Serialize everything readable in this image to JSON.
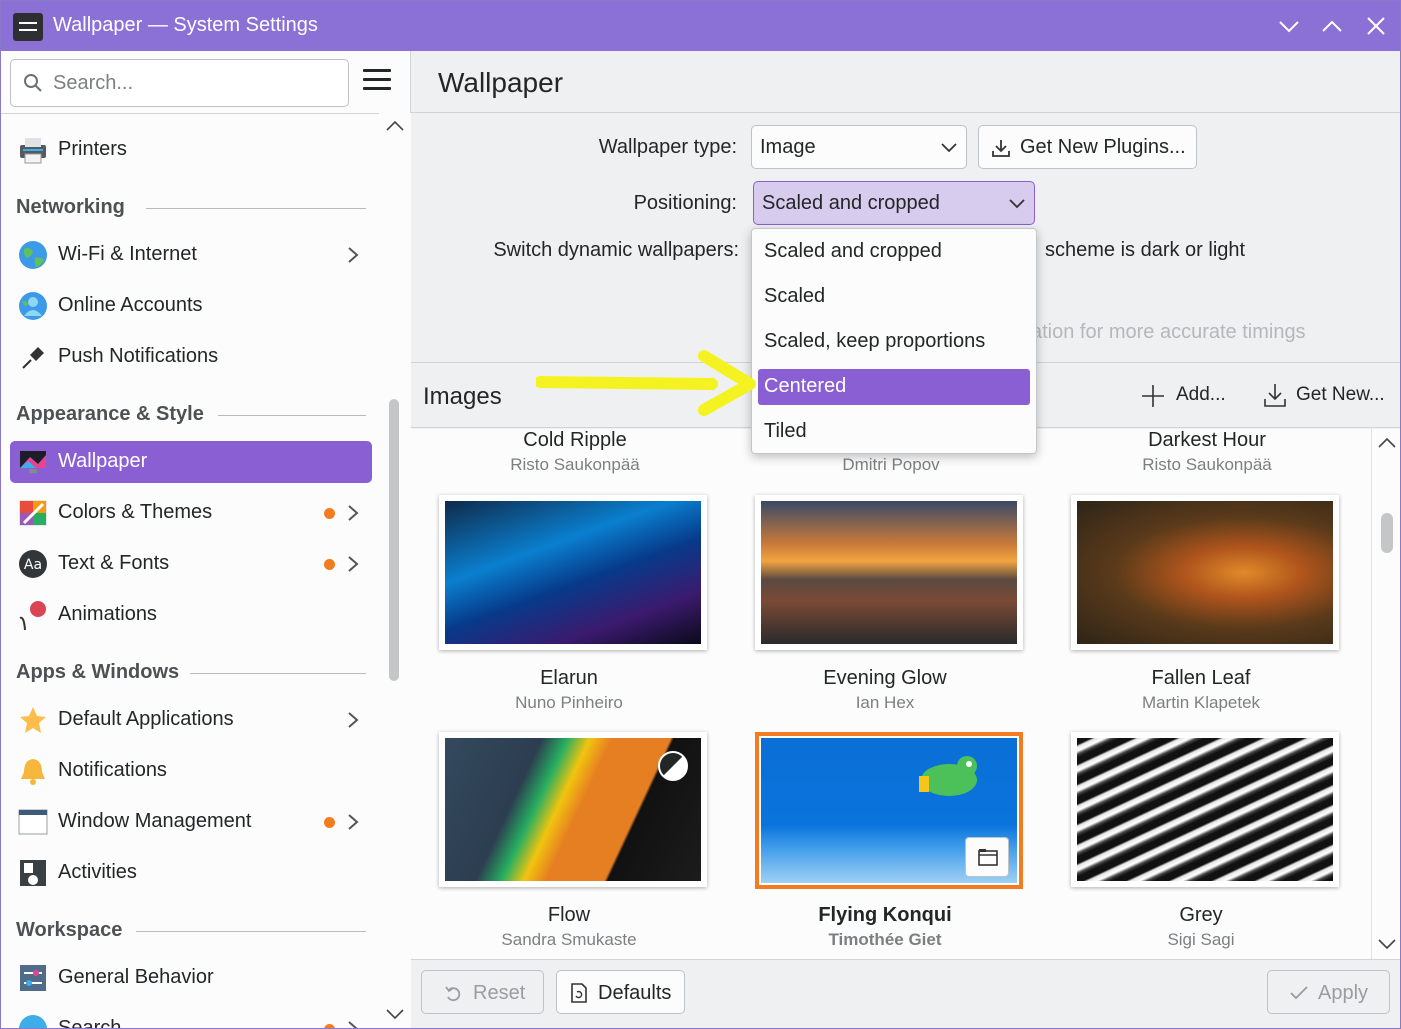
{
  "window": {
    "title": "Wallpaper — System Settings"
  },
  "sidebar": {
    "search_placeholder": "Search...",
    "items": [
      {
        "label": "Printers"
      },
      {
        "heading": "Networking"
      },
      {
        "label": "Wi-Fi & Internet",
        "chevron": true
      },
      {
        "label": "Online Accounts"
      },
      {
        "label": "Push Notifications"
      },
      {
        "heading": "Appearance & Style"
      },
      {
        "label": "Wallpaper",
        "active": true
      },
      {
        "label": "Colors & Themes",
        "dot": true,
        "chevron": true
      },
      {
        "label": "Text & Fonts",
        "dot": true,
        "chevron": true
      },
      {
        "label": "Animations"
      },
      {
        "heading": "Apps & Windows"
      },
      {
        "label": "Default Applications",
        "chevron": true
      },
      {
        "label": "Notifications"
      },
      {
        "label": "Window Management",
        "dot": true,
        "chevron": true
      },
      {
        "label": "Activities"
      },
      {
        "heading": "Workspace"
      },
      {
        "label": "General Behavior"
      },
      {
        "label": "Search",
        "dot": true,
        "chevron": true
      }
    ]
  },
  "main": {
    "title": "Wallpaper",
    "wallpaper_type_label": "Wallpaper type:",
    "wallpaper_type_value": "Image",
    "get_plugins_label": "Get New Plugins...",
    "positioning_label": "Positioning:",
    "positioning_value": "Scaled and cropped",
    "switch_label": "Switch dynamic wallpapers:",
    "switch_value_visible": "scheme is dark or light",
    "hint_visible": "ation for more accurate timings",
    "images_title": "Images",
    "add_label": "Add...",
    "get_new_label": "Get New...",
    "wallpapers": [
      {
        "name": "Cold Ripple",
        "author": "Risto Saukonpää"
      },
      {
        "name": "",
        "author": "Dmitri Popov"
      },
      {
        "name": "Darkest Hour",
        "author": "Risto Saukonpää"
      },
      {
        "name": "Elarun",
        "author": "Nuno Pinheiro"
      },
      {
        "name": "Evening Glow",
        "author": "Ian Hex"
      },
      {
        "name": "Fallen Leaf",
        "author": "Martin Klapetek"
      },
      {
        "name": "Flow",
        "author": "Sandra Smukaste"
      },
      {
        "name": "Flying Konqui",
        "author": "Timothée Giet",
        "selected": true
      },
      {
        "name": "Grey",
        "author": "Sigi Sagi"
      }
    ],
    "reset_label": "Reset",
    "defaults_label": "Defaults",
    "apply_label": "Apply"
  },
  "positioning_popup": {
    "options": [
      "Scaled and cropped",
      "Scaled",
      "Scaled, keep proportions",
      "Centered",
      "Tiled"
    ],
    "highlighted": "Centered"
  },
  "colors": {
    "accent": "#8b5fd4",
    "titlebar": "#8b70d6",
    "selection_border": "#f47c20",
    "annotation_arrow": "#f5f221"
  }
}
